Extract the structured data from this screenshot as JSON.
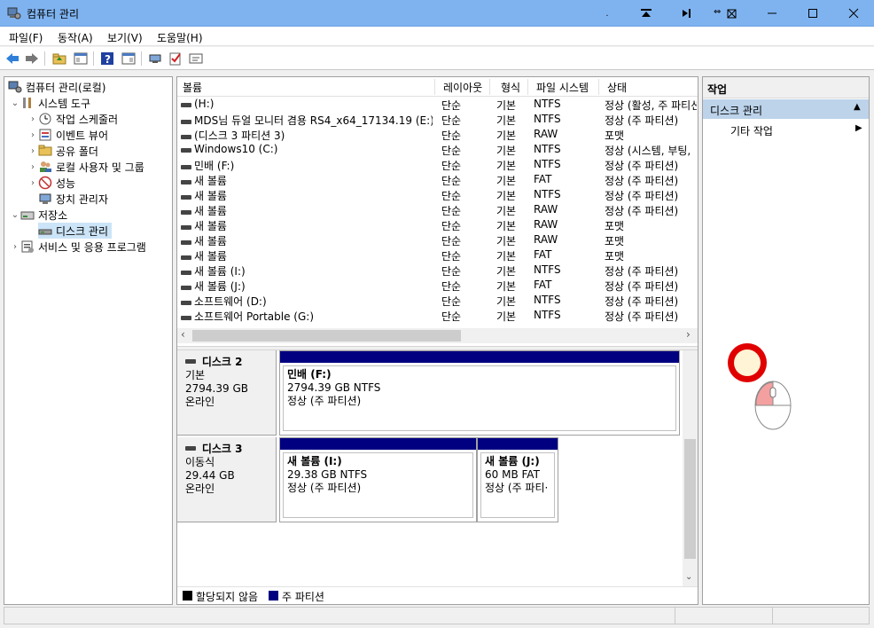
{
  "window": {
    "title": "컴퓨터 관리"
  },
  "titlebar_buttons": [
    "-",
    "⏶",
    "⇤",
    "⇔",
    "—",
    "☐",
    "✕"
  ],
  "menu": [
    "파일(F)",
    "동작(A)",
    "보기(V)",
    "도움말(H)"
  ],
  "tree": {
    "root": "컴퓨터 관리(로컬)",
    "system_tools": "시스템 도구",
    "task_scheduler": "작업 스케줄러",
    "event_viewer": "이벤트 뷰어",
    "shared_folders": "공유 폴더",
    "local_users": "로컬 사용자 및 그룹",
    "performance": "성능",
    "device_manager": "장치 관리자",
    "storage": "저장소",
    "disk_management": "디스크 관리",
    "services": "서비스 및 응용 프로그램"
  },
  "volume_columns": [
    "볼륨",
    "레이아웃",
    "형식",
    "파일 시스템",
    "상태"
  ],
  "volumes": [
    {
      "name": "(H:)",
      "layout": "단순",
      "type": "기본",
      "fs": "NTFS",
      "status": "정상 (활성, 주 파티션)"
    },
    {
      "name": "MDS님 듀얼 모니터 겸용 RS4_x64_17134.19 (E:)",
      "layout": "단순",
      "type": "기본",
      "fs": "NTFS",
      "status": "정상 (주 파티션)"
    },
    {
      "name": "(디스크 3 파티션 3)",
      "layout": "단순",
      "type": "기본",
      "fs": "RAW",
      "status": "포맷"
    },
    {
      "name": "Windows10 (C:)",
      "layout": "단순",
      "type": "기본",
      "fs": "NTFS",
      "status": "정상 (시스템, 부팅,"
    },
    {
      "name": "민배 (F:)",
      "layout": "단순",
      "type": "기본",
      "fs": "NTFS",
      "status": "정상 (주 파티션)"
    },
    {
      "name": "새 볼륨",
      "layout": "단순",
      "type": "기본",
      "fs": "FAT",
      "status": "정상 (주 파티션)"
    },
    {
      "name": "새 볼륨",
      "layout": "단순",
      "type": "기본",
      "fs": "NTFS",
      "status": "정상 (주 파티션)"
    },
    {
      "name": "새 볼륨",
      "layout": "단순",
      "type": "기본",
      "fs": "RAW",
      "status": "정상 (주 파티션)"
    },
    {
      "name": "새 볼륨",
      "layout": "단순",
      "type": "기본",
      "fs": "RAW",
      "status": "포맷"
    },
    {
      "name": "새 볼륨",
      "layout": "단순",
      "type": "기본",
      "fs": "RAW",
      "status": "포맷"
    },
    {
      "name": "새 볼륨",
      "layout": "단순",
      "type": "기본",
      "fs": "FAT",
      "status": "포맷"
    },
    {
      "name": "새 볼륨 (I:)",
      "layout": "단순",
      "type": "기본",
      "fs": "NTFS",
      "status": "정상 (주 파티션)"
    },
    {
      "name": "새 볼륨 (J:)",
      "layout": "단순",
      "type": "기본",
      "fs": "FAT",
      "status": "정상 (주 파티션)"
    },
    {
      "name": "소프트웨어 (D:)",
      "layout": "단순",
      "type": "기본",
      "fs": "NTFS",
      "status": "정상 (주 파티션)"
    },
    {
      "name": "소프트웨어 Portable (G:)",
      "layout": "단순",
      "type": "기본",
      "fs": "NTFS",
      "status": "정상 (주 파티션)"
    }
  ],
  "disks": [
    {
      "name": "디스크 2",
      "type": "기본",
      "size": "2794.39 GB",
      "state": "온라인",
      "partitions": [
        {
          "name": "민배  (F:)",
          "size": "2794.39 GB NTFS",
          "status": "정상 (주 파티션)"
        }
      ]
    },
    {
      "name": "디스크 3",
      "type": "이동식",
      "size": "29.44 GB",
      "state": "온라인",
      "partitions": [
        {
          "name": "새 볼륨  (I:)",
          "size": "29.38 GB NTFS",
          "status": "정상 (주 파티션)"
        },
        {
          "name": "새 볼륨  (J:)",
          "size": "60 MB FAT",
          "status": "정상 (주 파티·"
        }
      ]
    }
  ],
  "legend": {
    "unallocated": "할당되지 않음",
    "primary": "주 파티션"
  },
  "actions": {
    "header": "작업",
    "section": "디스크 관리",
    "more": "기타 작업"
  },
  "colors": {
    "titlebar": "#7fb3f0",
    "primary_partition": "#000080",
    "action_section": "#bcd3ea",
    "cursor_ring": "#e00000"
  }
}
